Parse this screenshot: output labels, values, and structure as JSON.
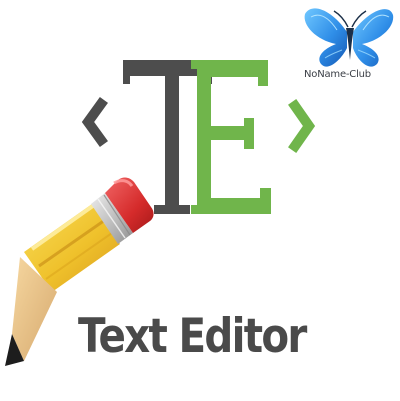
{
  "logo": {
    "title": "Text Editor",
    "letters": {
      "left": "T",
      "right": "E"
    },
    "brackets": {
      "left": "<",
      "right": ">"
    },
    "icons": {
      "pencil": "pencil-icon",
      "watermark": "butterfly-icon"
    },
    "colors": {
      "dark": "#4d4d4d",
      "green": "#70b54b",
      "text": "#4a4a4a",
      "pencil_red": "#d52b2b",
      "pencil_yellow": "#f0c12d",
      "butterfly_blue": "#2f8ee8"
    }
  },
  "watermark": {
    "text": "NoName-Club"
  }
}
